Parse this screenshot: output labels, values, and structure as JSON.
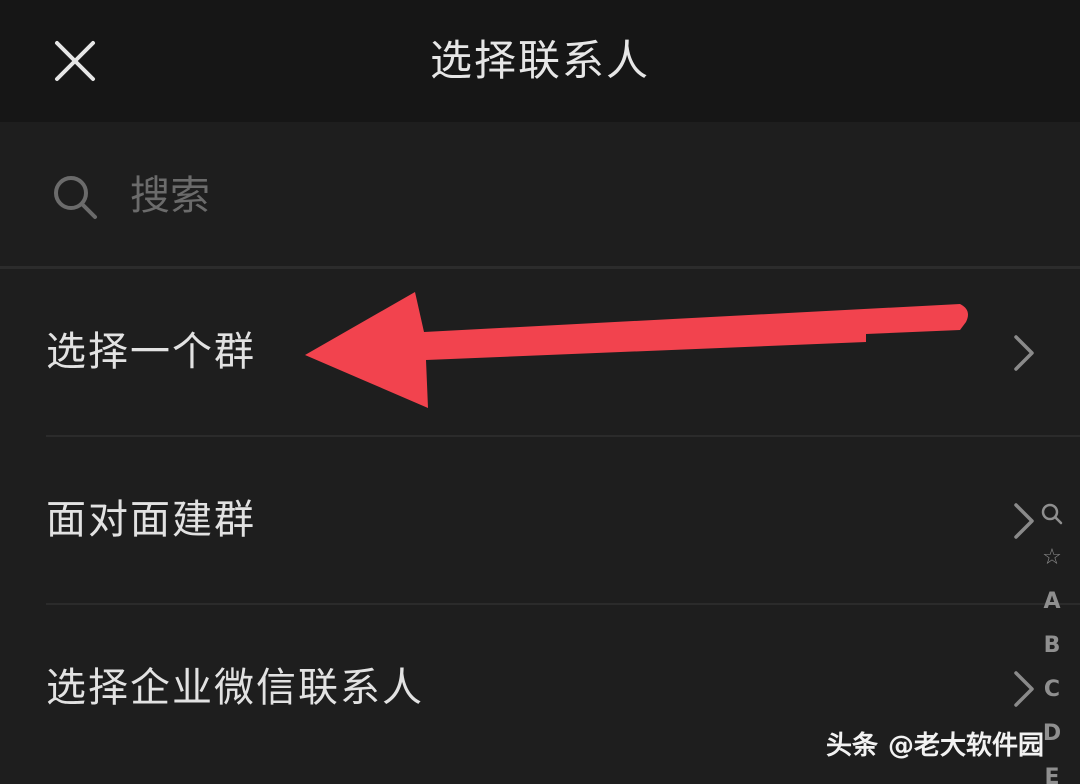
{
  "header": {
    "title": "选择联系人"
  },
  "search": {
    "placeholder": "搜索",
    "value": ""
  },
  "menu": {
    "items": [
      {
        "label": "选择一个群"
      },
      {
        "label": "面对面建群"
      },
      {
        "label": "选择企业微信联系人"
      }
    ]
  },
  "index_bar": {
    "entries": [
      "☆",
      "A",
      "B",
      "C",
      "D",
      "E"
    ]
  },
  "annotation": {
    "arrow_color": "#f2434e"
  },
  "watermark": {
    "brand": "头条",
    "account": "@老大软件园"
  },
  "colors": {
    "background": "#1e1e1e",
    "header_background": "#161616",
    "text_primary": "#e2e2e2",
    "text_placeholder": "#6b6b6b",
    "divider": "#2b2b2b"
  }
}
